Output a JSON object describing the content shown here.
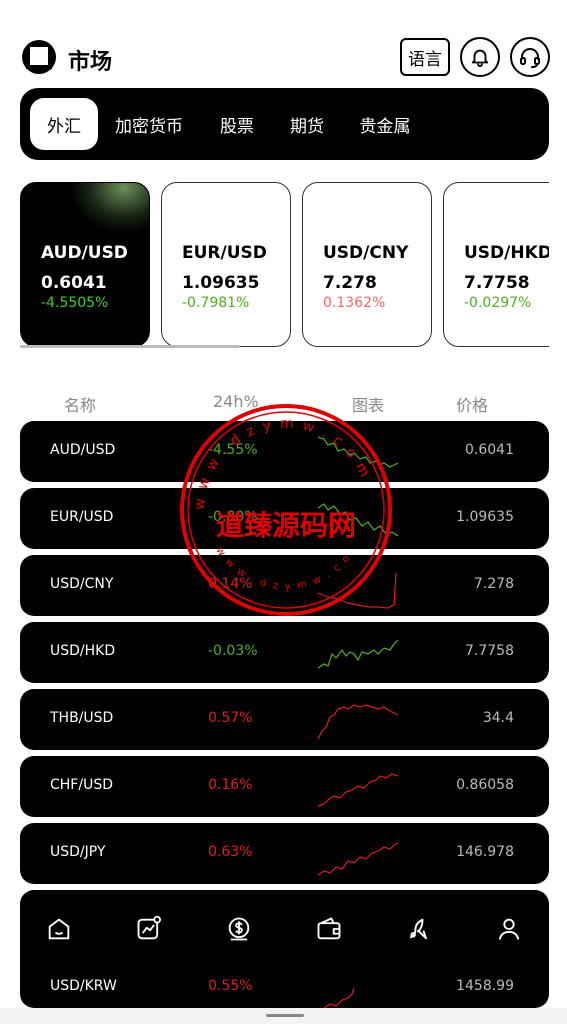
{
  "header": {
    "title": "市场",
    "lang_label": "语言",
    "icons": [
      "logo-icon",
      "bell-icon",
      "headset-icon"
    ]
  },
  "tabs": [
    {
      "label": "外汇",
      "active": true
    },
    {
      "label": "加密货币",
      "active": false
    },
    {
      "label": "股票",
      "active": false
    },
    {
      "label": "期货",
      "active": false
    },
    {
      "label": "贵金属",
      "active": false
    }
  ],
  "cards": [
    {
      "symbol": "AUD/USD",
      "price": "0.6041",
      "change": "-4.5505%",
      "direction": "down",
      "active": true
    },
    {
      "symbol": "EUR/USD",
      "price": "1.09635",
      "change": "-0.7981%",
      "direction": "down",
      "active": false
    },
    {
      "symbol": "USD/CNY",
      "price": "7.278",
      "change": "0.1362%",
      "direction": "up",
      "active": false
    },
    {
      "symbol": "USD/HKD",
      "price": "7.7758",
      "change": "-0.0297%",
      "direction": "down",
      "active": false
    }
  ],
  "list_header": {
    "name": "名称",
    "change": "24h%",
    "chart": "图表",
    "price": "价格"
  },
  "rows": [
    {
      "name": "AUD/USD",
      "change": "-4.55%",
      "price": "0.6041",
      "direction": "down"
    },
    {
      "name": "EUR/USD",
      "change": "-0.80%",
      "price": "1.09635",
      "direction": "down"
    },
    {
      "name": "USD/CNY",
      "change": "0.14%",
      "price": "7.278",
      "direction": "up"
    },
    {
      "name": "USD/HKD",
      "change": "-0.03%",
      "price": "7.7758",
      "direction": "down"
    },
    {
      "name": "THB/USD",
      "change": "0.57%",
      "price": "34.4",
      "direction": "up"
    },
    {
      "name": "CHF/USD",
      "change": "0.16%",
      "price": "0.86058",
      "direction": "up"
    },
    {
      "name": "USD/JPY",
      "change": "0.63%",
      "price": "146.978",
      "direction": "up"
    },
    {
      "name": "USD/KRW",
      "change": "0.55%",
      "price": "1458.99",
      "direction": "up"
    }
  ],
  "bottom_nav": [
    "home-icon",
    "market-icon",
    "trade-icon",
    "wallet-icon",
    "rocket-icon",
    "profile-icon"
  ],
  "watermark": {
    "text": "道臻源码网",
    "ring_text": "w w w . d z y m w . c o m"
  },
  "colors": {
    "up": "#e01c1c",
    "down": "#4fae21",
    "watermark": "#e00000"
  }
}
